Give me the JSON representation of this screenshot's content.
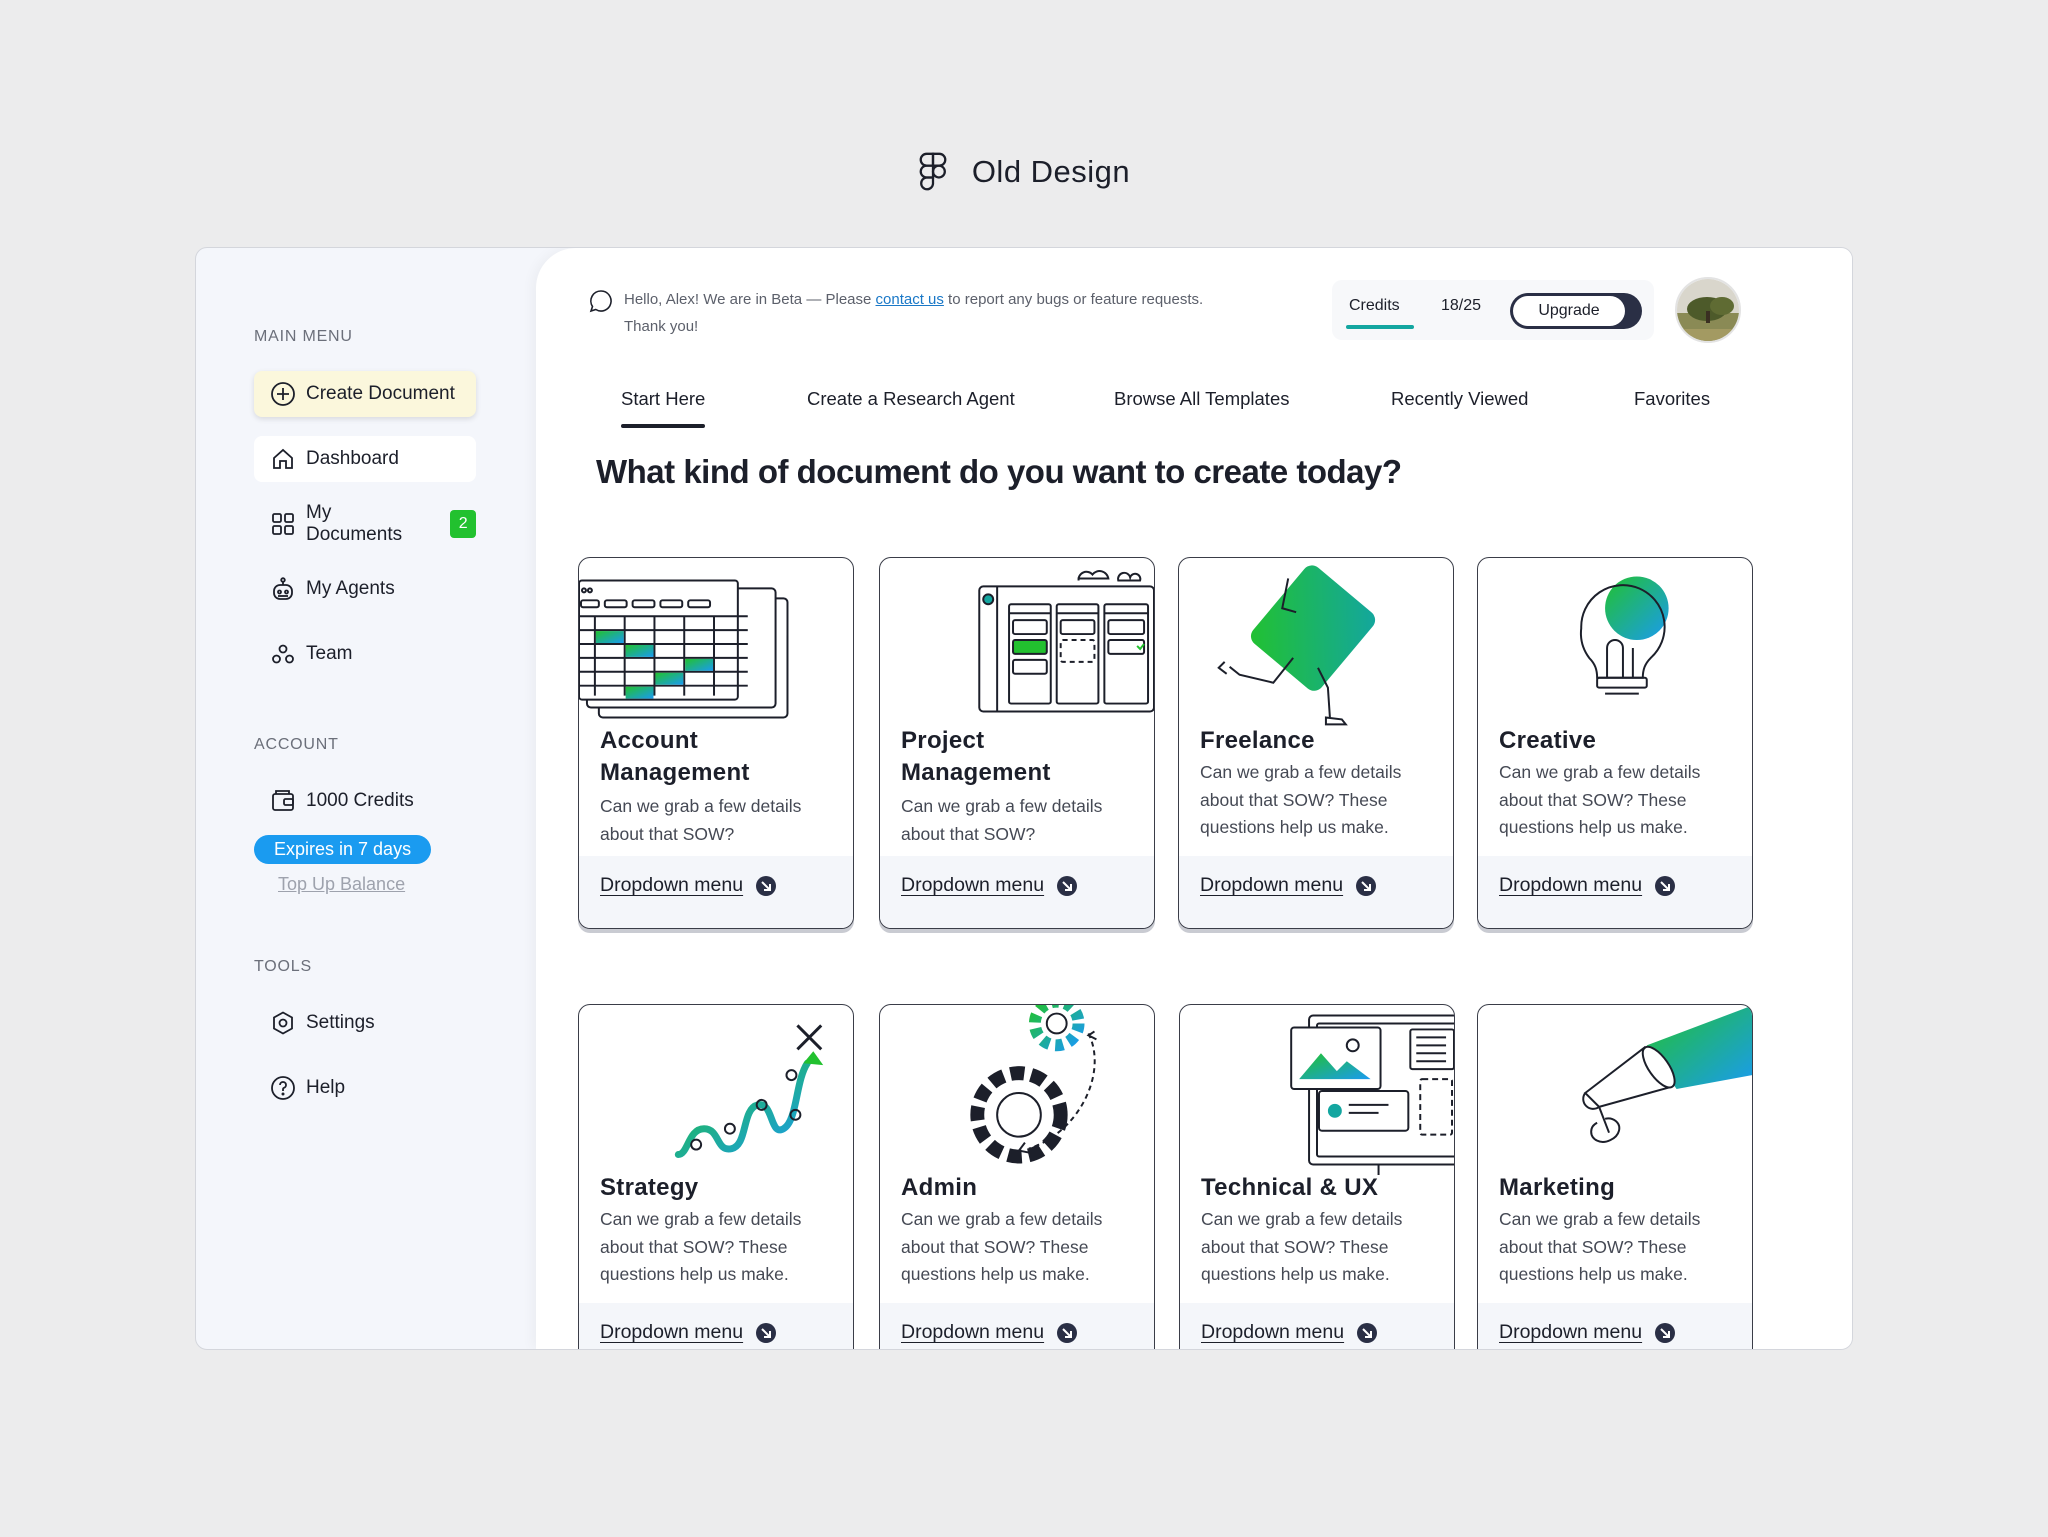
{
  "caption": {
    "title": "Old Design"
  },
  "sidebar": {
    "main_menu_label": "MAIN MENU",
    "items": [
      {
        "label": "Create Document"
      },
      {
        "label": "Dashboard"
      },
      {
        "label": "My Documents",
        "badge": "2"
      },
      {
        "label": "My Agents"
      },
      {
        "label": "Team"
      }
    ],
    "account_label": "ACCOUNT",
    "credits_label": "1000 Credits",
    "expires_label": "Expires in 7 days",
    "topup_label": "Top Up Balance",
    "tools_label": "TOOLS",
    "settings_label": "Settings",
    "help_label": "Help"
  },
  "header": {
    "beta_prefix": "Hello, Alex!  We are in Beta — Please ",
    "beta_link": "contact us",
    "beta_suffix": " to report any bugs or feature requests.",
    "beta_line2": "Thank you!",
    "credits_label": "Credits",
    "credits_count": "18/25",
    "upgrade_label": "Upgrade"
  },
  "tabs": [
    {
      "label": "Start Here"
    },
    {
      "label": "Create a Research Agent"
    },
    {
      "label": "Browse All Templates"
    },
    {
      "label": "Recently Viewed"
    },
    {
      "label": "Favorites"
    }
  ],
  "headline": "What kind of document do you want to create today?",
  "cards": [
    {
      "title_l1": "Account",
      "title_l2": "Management",
      "desc": "Can we grab a few details about that SOW?",
      "dropdown": "Dropdown menu"
    },
    {
      "title_l1": "Project",
      "title_l2": "Management",
      "desc": "Can we grab a few details about that SOW?",
      "dropdown": "Dropdown menu"
    },
    {
      "title": "Freelance",
      "desc": "Can we grab a few details about that SOW? These questions help us make.",
      "dropdown": "Dropdown menu"
    },
    {
      "title": "Creative",
      "desc": "Can we grab a few details about that SOW? These questions help us make.",
      "dropdown": "Dropdown menu"
    },
    {
      "title": "Strategy",
      "desc": "Can we grab a few details about that SOW? These questions help us make.",
      "dropdown": "Dropdown menu"
    },
    {
      "title": "Admin",
      "desc": "Can we grab a few details about that SOW? These questions help us make.",
      "dropdown": "Dropdown menu"
    },
    {
      "title": "Technical & UX",
      "desc": "Can we grab a few details about that SOW? These questions help us make.",
      "dropdown": "Dropdown menu"
    },
    {
      "title": "Marketing",
      "desc": "Can we grab a few details about that SOW? These questions help us make.",
      "dropdown": "Dropdown menu"
    }
  ],
  "colors": {
    "accent_green": "#22c12f",
    "accent_blue": "#1a9bf0",
    "teal": "#13a6a0",
    "dark": "#2a2f45"
  }
}
